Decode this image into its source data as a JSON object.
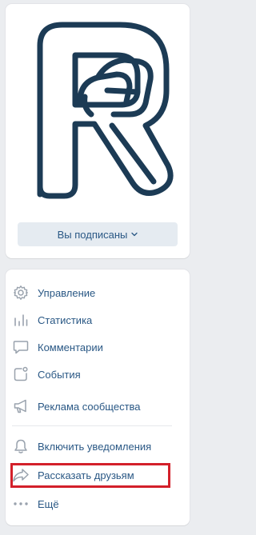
{
  "group": {
    "subscribe_label": "Вы подписаны"
  },
  "menu": {
    "items": [
      {
        "key": "manage",
        "label": "Управление",
        "icon": "gear-icon"
      },
      {
        "key": "stats",
        "label": "Статистика",
        "icon": "stats-bars-icon"
      },
      {
        "key": "comments",
        "label": "Комментарии",
        "icon": "comment-icon"
      },
      {
        "key": "events",
        "label": "События",
        "icon": "events-icon"
      },
      {
        "key": "ads",
        "label": "Реклама сообщества",
        "icon": "megaphone-icon"
      },
      {
        "key": "notify",
        "label": "Включить уведомления",
        "icon": "bell-icon"
      },
      {
        "key": "share",
        "label": "Рассказать друзьям",
        "icon": "share-arrow-icon"
      },
      {
        "key": "more",
        "label": "Ещё",
        "icon": "more-dots-icon"
      }
    ]
  },
  "colors": {
    "link": "#2a5885",
    "icon": "#99a2ad",
    "logo": "#1c3b55",
    "highlight": "#d3202a",
    "button_bg": "#e5ebf1"
  }
}
